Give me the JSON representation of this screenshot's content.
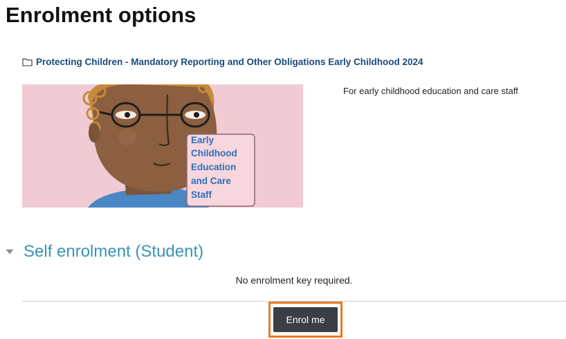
{
  "page": {
    "title": "Enrolment options"
  },
  "course": {
    "name": "Protecting Children - Mandatory Reporting and Other Obligations Early Childhood 2024",
    "folder_icon": "folder-icon",
    "summary": "For early childhood education and care staff",
    "image": {
      "background_color": "#f1cbd3",
      "label_lines": [
        "Early",
        "Childhood",
        "Education",
        "and Care",
        "Staff"
      ],
      "label_color": "#2f6fb6"
    }
  },
  "enrolment": {
    "section_title": "Self enrolment (Student)",
    "section_icon": "caret-down-icon",
    "key_note": "No enrolment key required.",
    "button_label": "Enrol me",
    "highlight_color": "#e87a22",
    "button_color": "#3a3f45"
  }
}
